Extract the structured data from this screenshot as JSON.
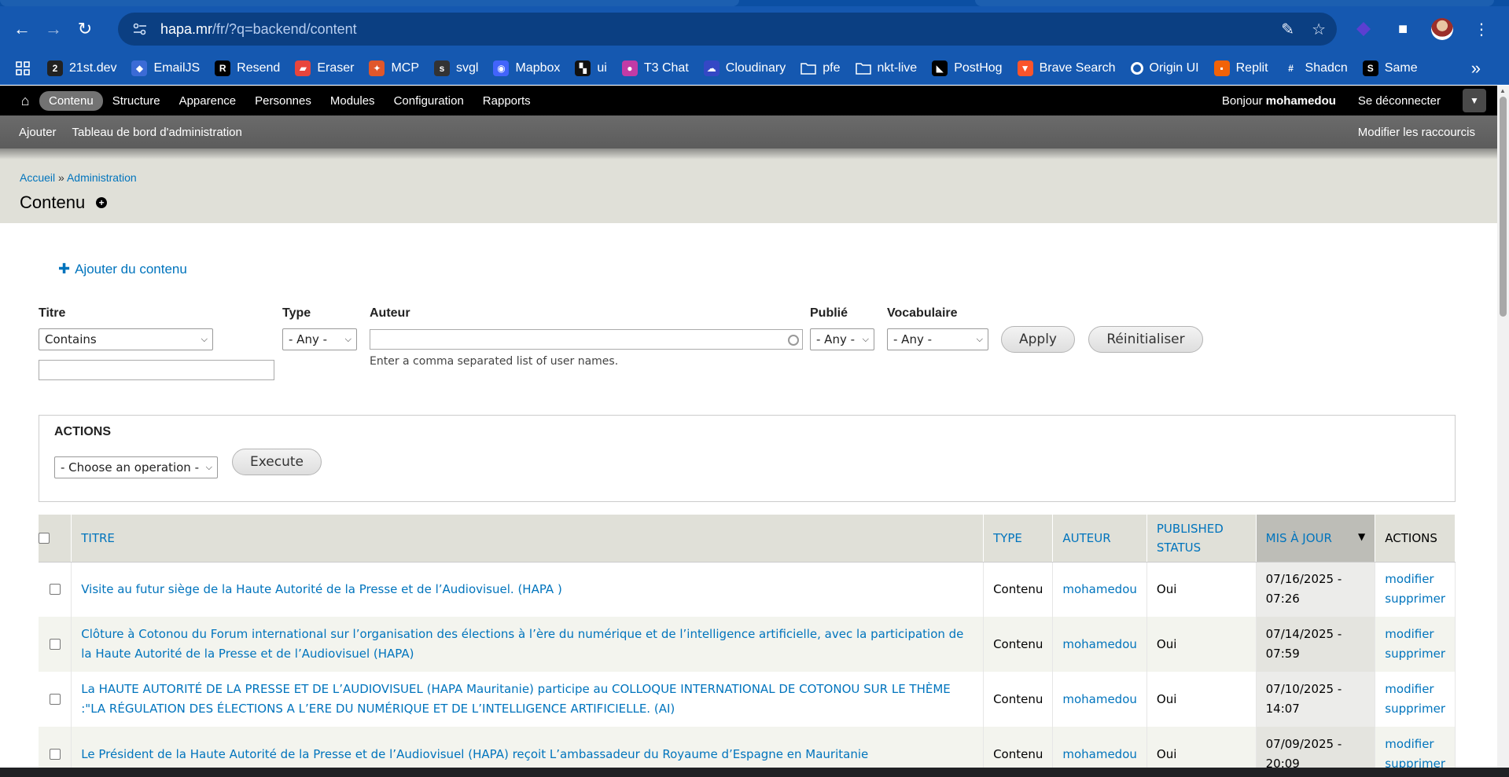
{
  "browser": {
    "url_host": "hapa.mr",
    "url_path": "/fr/?q=backend/content",
    "bookmarks": [
      {
        "label": "21st.dev",
        "icon": "21st-icon",
        "color": "#222222"
      },
      {
        "label": "EmailJS",
        "icon": "emailjs-icon",
        "color": "#3b6bd6"
      },
      {
        "label": "Resend",
        "icon": "resend-icon",
        "color": "#000000"
      },
      {
        "label": "Eraser",
        "icon": "eraser-icon",
        "color": "#e8453c"
      },
      {
        "label": "MCP",
        "icon": "mcp-icon",
        "color": "#e0572b"
      },
      {
        "label": "svgl",
        "icon": "svgl-icon",
        "color": "#333333"
      },
      {
        "label": "Mapbox",
        "icon": "mapbox-icon",
        "color": "#4264fb"
      },
      {
        "label": "ui",
        "icon": "ui-icon",
        "color": "#111111"
      },
      {
        "label": "T3 Chat",
        "icon": "t3chat-icon",
        "color": "#c23ba6"
      },
      {
        "label": "Cloudinary",
        "icon": "cloudinary-icon",
        "color": "#3448c5"
      },
      {
        "label": "pfe",
        "icon": "folder-icon",
        "color": "#1558b0"
      },
      {
        "label": "nkt-live",
        "icon": "folder-icon",
        "color": "#1558b0"
      },
      {
        "label": "PostHog",
        "icon": "posthog-icon",
        "color": "#000000"
      },
      {
        "label": "Brave Search",
        "icon": "brave-icon",
        "color": "#fb542b"
      },
      {
        "label": "Origin UI",
        "icon": "originui-icon",
        "color": "#ffffff"
      },
      {
        "label": "Replit",
        "icon": "replit-icon",
        "color": "#f26207"
      },
      {
        "label": "Shadcn",
        "icon": "shadcn-icon",
        "color": "#1558b0"
      },
      {
        "label": "Same",
        "icon": "same-icon",
        "color": "#000000"
      }
    ]
  },
  "admin": {
    "menu": [
      "Contenu",
      "Structure",
      "Apparence",
      "Personnes",
      "Modules",
      "Configuration",
      "Rapports"
    ],
    "active_menu": "Contenu",
    "greeting": "Bonjour",
    "username": "mohamedou",
    "logout": "Se déconnecter",
    "shortcuts": [
      "Ajouter",
      "Tableau de bord d'administration"
    ],
    "edit_shortcuts": "Modifier les raccourcis"
  },
  "page": {
    "breadcrumb": [
      "Accueil",
      "Administration"
    ],
    "breadcrumb_sep": "»",
    "title": "Contenu",
    "add_content": "Ajouter du contenu"
  },
  "filters": {
    "titre_label": "Titre",
    "titre_operator": "Contains",
    "type_label": "Type",
    "type_value": "- Any -",
    "auteur_label": "Auteur",
    "auteur_hint": "Enter a comma separated list of user names.",
    "publie_label": "Publié",
    "publie_value": "- Any -",
    "vocab_label": "Vocabulaire",
    "vocab_value": "- Any -",
    "apply": "Apply",
    "reset": "Réinitialiser"
  },
  "actions": {
    "legend": "ACTIONS",
    "operation": "- Choose an operation -",
    "execute": "Execute"
  },
  "table": {
    "headers": {
      "titre": "TITRE",
      "type": "TYPE",
      "auteur": "AUTEUR",
      "status_line1": "PUBLISHED",
      "status_line2": "STATUS",
      "updated": "MIS À JOUR",
      "actions": "ACTIONS"
    },
    "rows": [
      {
        "title": "Visite au futur siège de la Haute Autorité de la Presse et de l’Audiovisuel. (HAPA )",
        "type": "Contenu",
        "author": "mohamedou",
        "status": "Oui",
        "date": "07/16/2025 -",
        "time": "07:26",
        "edit": "modifier",
        "delete": "supprimer"
      },
      {
        "title": "Clôture à Cotonou du Forum international sur l’organisation des élections à l’ère du numérique et de l’intelligence artificielle, avec la participation de la Haute Autorité de la Presse et de l’Audiovisuel (HAPA)",
        "type": "Contenu",
        "author": "mohamedou",
        "status": "Oui",
        "date": "07/14/2025 -",
        "time": "07:59",
        "edit": "modifier",
        "delete": "supprimer"
      },
      {
        "title": "La HAUTE AUTORITÉ DE LA PRESSE ET DE L’AUDIOVISUEL (HAPA Mauritanie) participe au COLLOQUE INTERNATIONAL DE COTONOU SUR LE THÈME :\"LA RÉGULATION DES ÉLECTIONS A L’ERE DU NUMÉRIQUE ET DE L’INTELLIGENCE ARTIFICIELLE. (AI)",
        "type": "Contenu",
        "author": "mohamedou",
        "status": "Oui",
        "date": "07/10/2025 -",
        "time": "14:07",
        "edit": "modifier",
        "delete": "supprimer"
      },
      {
        "title": "Le Président de la Haute Autorité de la Presse et de l’Audiovisuel (HAPA) reçoit L’ambassadeur du Royaume d’Espagne en Mauritanie",
        "type": "Contenu",
        "author": "mohamedou",
        "status": "Oui",
        "date": "07/09/2025 -",
        "time": "20:09",
        "edit": "modifier",
        "delete": "supprimer"
      }
    ]
  }
}
